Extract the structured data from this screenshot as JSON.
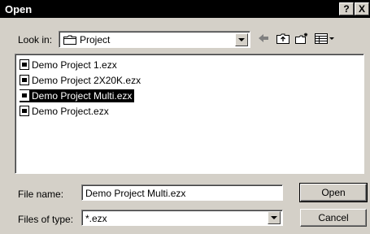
{
  "window": {
    "title": "Open",
    "help_label": "?",
    "close_label": "X"
  },
  "look_in": {
    "label": "Look in:",
    "value": "Project",
    "value_icon": "folder-icon"
  },
  "toolbar": {
    "icons": [
      "back-arrow-icon",
      "up-one-level-icon",
      "new-folder-icon",
      "view-menu-icon"
    ]
  },
  "files": [
    {
      "name": "Demo Project 1.ezx",
      "selected": false
    },
    {
      "name": "Demo Project 2X20K.ezx",
      "selected": false
    },
    {
      "name": "Demo Project Multi.ezx",
      "selected": true
    },
    {
      "name": "Demo Project.ezx",
      "selected": false
    }
  ],
  "file_name": {
    "label": "File name:",
    "value": "Demo Project Multi.ezx"
  },
  "file_type": {
    "label": "Files of type:",
    "value": "*.ezx"
  },
  "buttons": {
    "open_label": "Open",
    "cancel_label": "Cancel"
  }
}
